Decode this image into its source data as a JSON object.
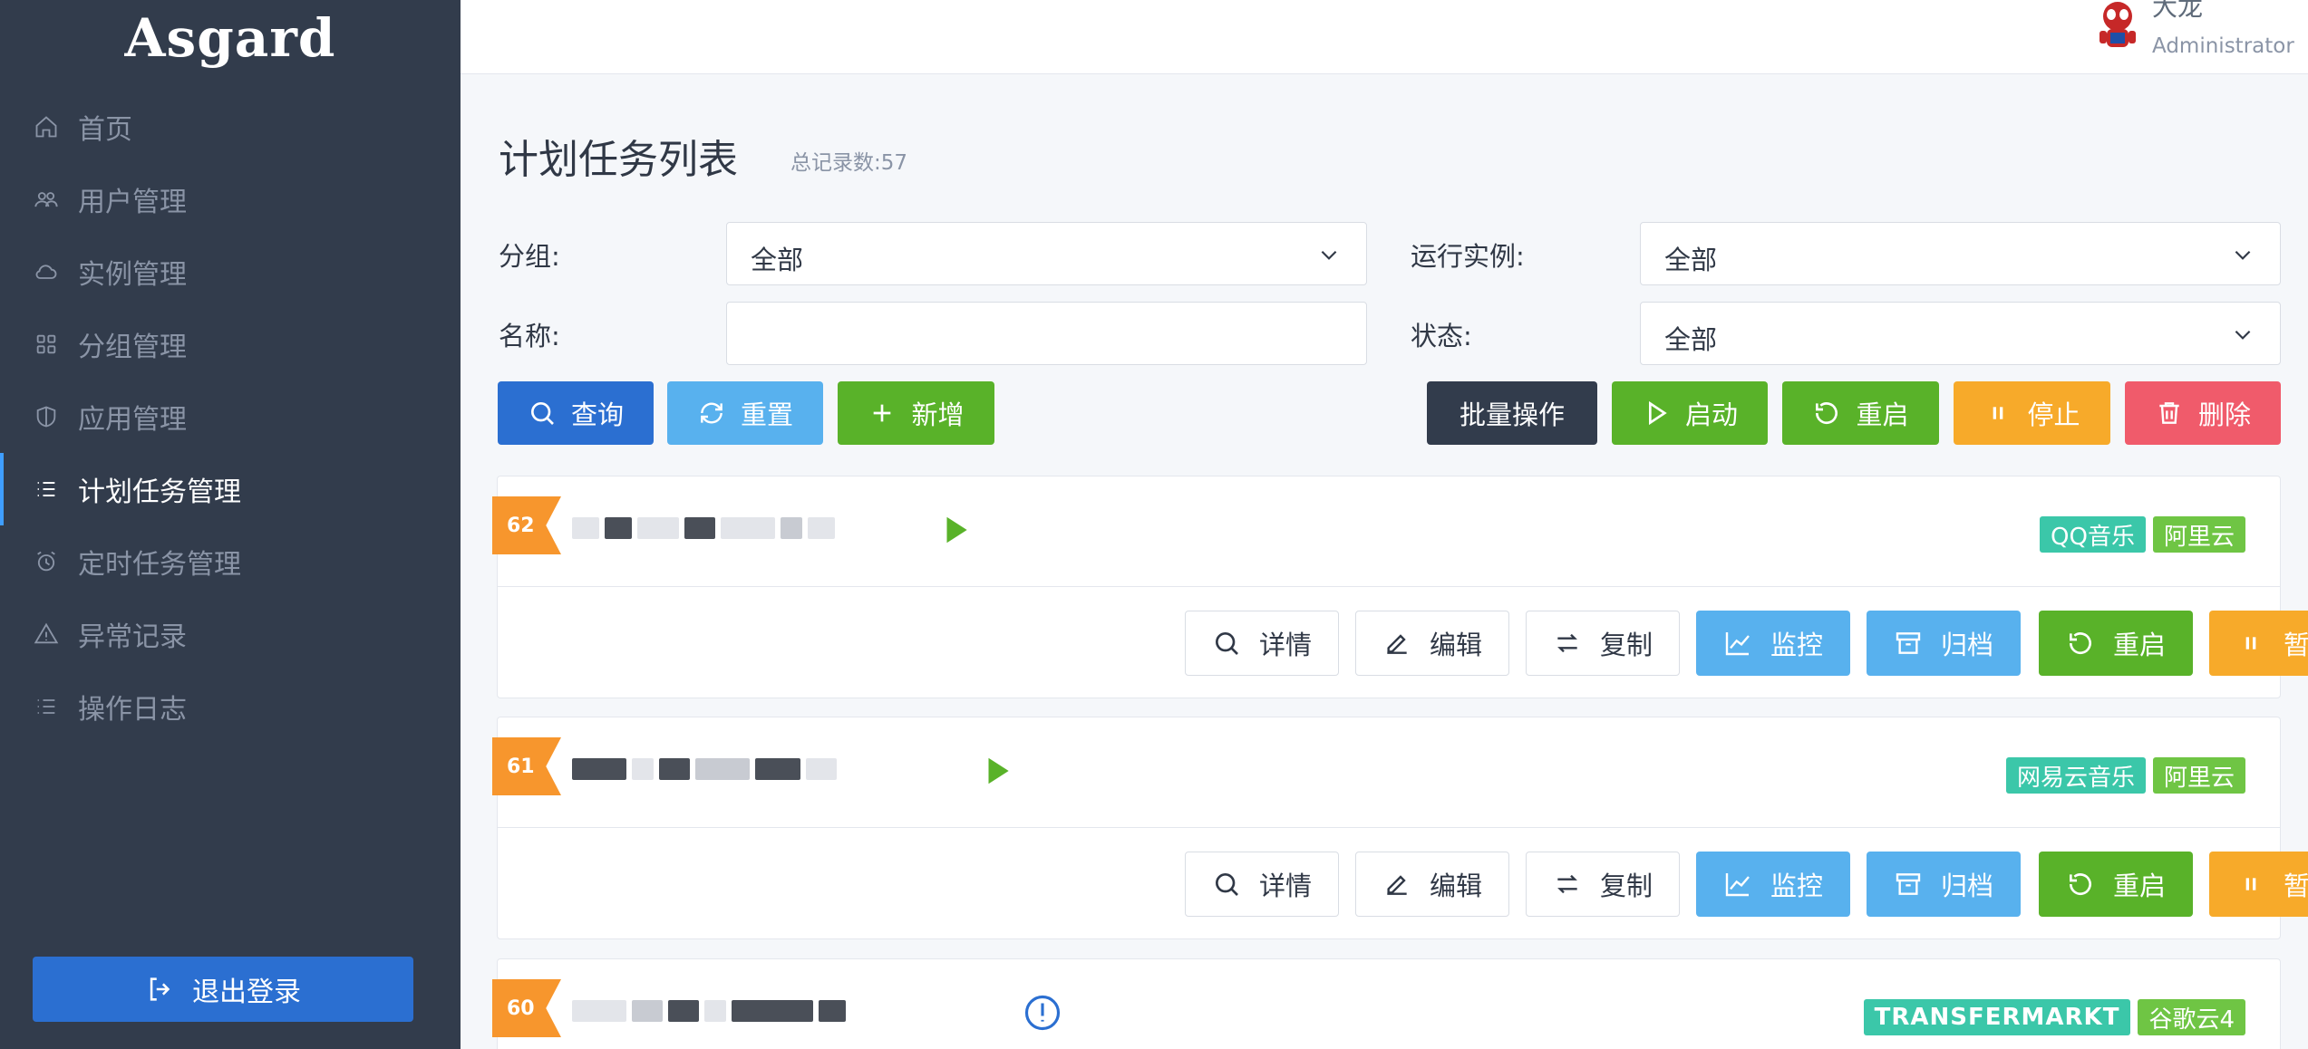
{
  "app": {
    "logo": "Asgard"
  },
  "sidebar": {
    "items": [
      {
        "label": "首页",
        "icon": "home-icon"
      },
      {
        "label": "用户管理",
        "icon": "users-icon"
      },
      {
        "label": "实例管理",
        "icon": "cloud-icon"
      },
      {
        "label": "分组管理",
        "icon": "grid-icon"
      },
      {
        "label": "应用管理",
        "icon": "shield-icon"
      },
      {
        "label": "计划任务管理",
        "icon": "list-icon",
        "active": true
      },
      {
        "label": "定时任务管理",
        "icon": "alarm-clock-icon"
      },
      {
        "label": "异常记录",
        "icon": "warning-icon"
      },
      {
        "label": "操作日志",
        "icon": "list-icon"
      }
    ],
    "logout_label": "退出登录"
  },
  "header": {
    "user_name": "大龙",
    "user_role": "Administrator"
  },
  "page": {
    "title": "计划任务列表",
    "record_count": "总记录数:57"
  },
  "filters": {
    "group_label": "分组:",
    "group_value": "全部",
    "instance_label": "运行实例:",
    "instance_value": "全部",
    "name_label": "名称:",
    "name_value": "",
    "status_label": "状态:",
    "status_value": "全部"
  },
  "toolbar": {
    "query": "查询",
    "reset": "重置",
    "add": "新增",
    "batch": "批量操作",
    "start": "启动",
    "restart": "重启",
    "stop": "停止",
    "delete": "删除"
  },
  "card_actions": {
    "detail": "详情",
    "edit": "编辑",
    "copy": "复制",
    "monitor": "监控",
    "archive": "归档",
    "restart": "重启",
    "pause": "暂停"
  },
  "tasks": [
    {
      "id": "62",
      "status": "running",
      "tags": [
        "QQ音乐",
        "阿里云"
      ]
    },
    {
      "id": "61",
      "status": "running",
      "tags": [
        "网易云音乐",
        "阿里云"
      ]
    },
    {
      "id": "60",
      "status": "error",
      "tags": [
        "TRANSFERMARKT",
        "谷歌云4"
      ]
    }
  ],
  "colors": {
    "sidebar_bg": "#323c4c",
    "primary": "#2b6fd1",
    "info": "#58b1ee",
    "success": "#59b229",
    "warning": "#f7aa2a",
    "danger": "#f05b6b",
    "ribbon": "#f7962d"
  }
}
